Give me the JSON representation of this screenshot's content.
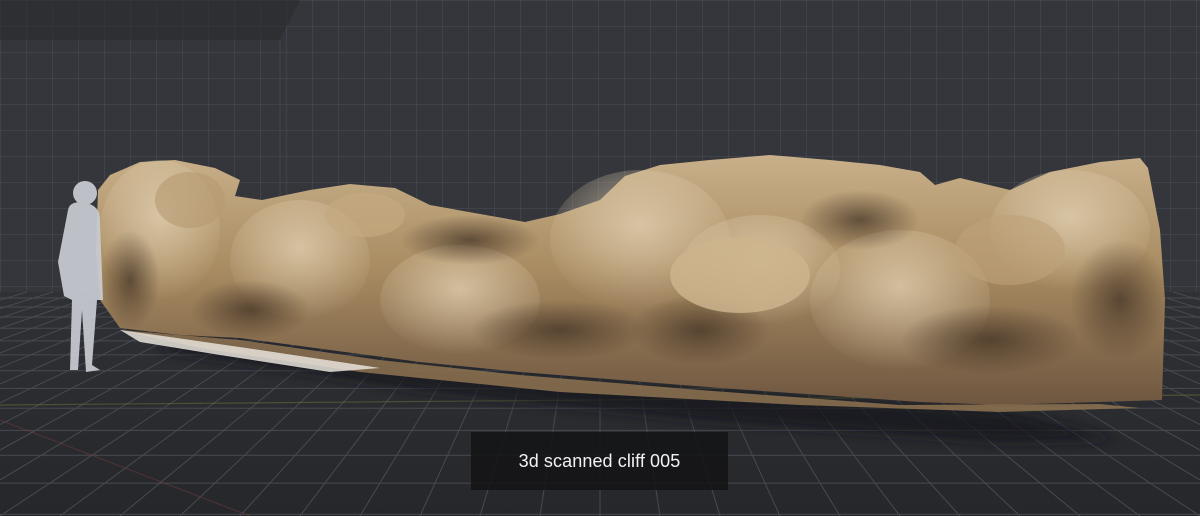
{
  "caption": "3d scanned cliff 005",
  "colors": {
    "wall": "#34363b",
    "floor": "#2e3034",
    "grid_line": "#4a4d54",
    "rock_light": "#d8c3a0",
    "rock_mid": "#a98c62",
    "rock_dark": "#5a4632",
    "human_silhouette": "#c9ccd3",
    "caption_background": "#141416",
    "caption_text": "#f2f2f2"
  },
  "scene": {
    "subject": "cliff-scan-model",
    "scale_reference": "human-silhouette"
  }
}
